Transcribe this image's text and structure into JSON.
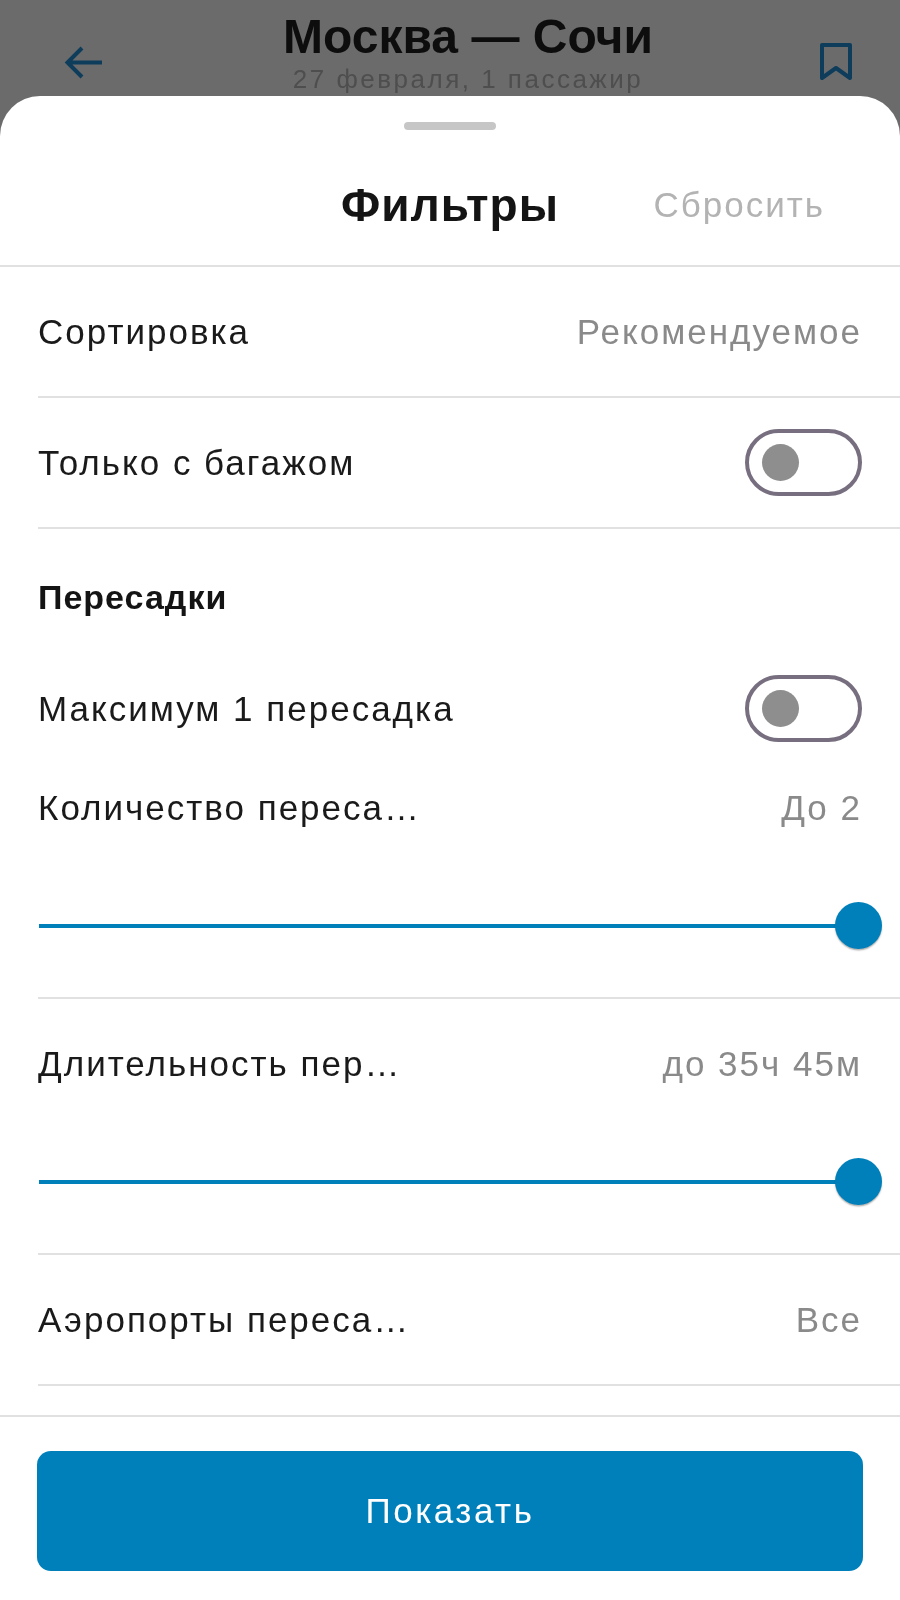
{
  "header": {
    "title": "Москва — Сочи",
    "subtitle": "27 февраля, 1 пассажир"
  },
  "sheet": {
    "title": "Фильтры",
    "reset": "Сбросить"
  },
  "groups": [
    {
      "rows": [
        {
          "kind": "select",
          "label": "Сортировка",
          "value": "Рекомендуемое"
        }
      ]
    },
    {
      "rows": [
        {
          "kind": "toggle",
          "label": "Только с багажом",
          "on": false
        }
      ]
    },
    {
      "title": "Пересадки",
      "rows": [
        {
          "kind": "toggle",
          "label": "Максимум 1 пересадка",
          "on": false
        },
        {
          "kind": "slider",
          "label": "Количество переса…",
          "value": "До 2",
          "level": 1
        }
      ]
    },
    {
      "rows": [
        {
          "kind": "slider",
          "label": "Длительность пер…",
          "value": "до 35ч 45м",
          "level": 1
        }
      ]
    },
    {
      "rows": [
        {
          "kind": "select",
          "label": "Аэропорты переса…",
          "value": "Все"
        }
      ]
    }
  ],
  "button": {
    "label": "Показать"
  }
}
